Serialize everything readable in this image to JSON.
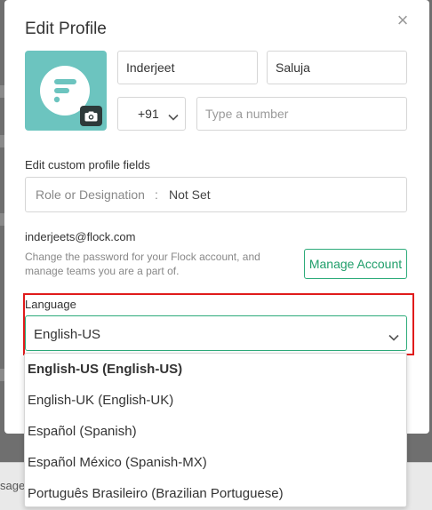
{
  "background": {
    "bottom_text": "sage"
  },
  "modal": {
    "title": "Edit Profile",
    "close_glyph": "×"
  },
  "profile": {
    "first_name": "Inderjeet",
    "last_name": "Saluja",
    "country_code": "+91",
    "phone_placeholder": "Type a number",
    "avatar_icon": "flock-logo-icon",
    "camera_icon": "camera-icon"
  },
  "custom_fields": {
    "heading": "Edit custom profile fields",
    "role_label": "Role or Designation",
    "separator": ":",
    "role_value": "Not Set"
  },
  "account": {
    "email": "inderjeets@flock.com",
    "helper_text": "Change the password for your Flock account, and manage teams you are a part of.",
    "manage_button": "Manage Account"
  },
  "language": {
    "label": "Language",
    "selected_value": "English-US",
    "options": [
      "English-US (English-US)",
      "English-UK (English-UK)",
      "Español (Spanish)",
      "Español México (Spanish-MX)",
      "Português Brasileiro (Brazilian Portuguese)"
    ]
  },
  "colors": {
    "accent_green": "#2dab7a",
    "avatar_teal": "#6cc4bf",
    "highlight_red": "#e01b1b"
  }
}
